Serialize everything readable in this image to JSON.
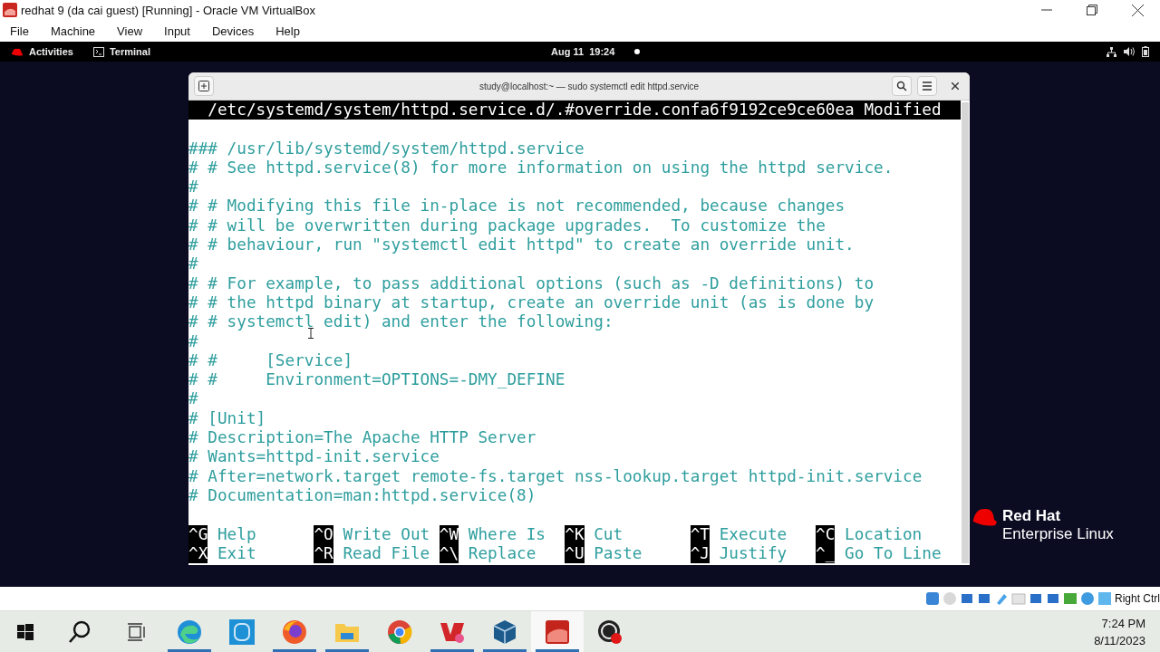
{
  "window": {
    "title": "redhat 9 (da cai guest) [Running] - Oracle VM VirtualBox"
  },
  "menu": [
    "File",
    "Machine",
    "View",
    "Input",
    "Devices",
    "Help"
  ],
  "gnome_bar": {
    "activities": "Activities",
    "app": "Terminal",
    "clock": "Aug 11  19:24"
  },
  "terminal": {
    "title": "study@localhost:~ — sudo systemctl edit httpd.service",
    "header": "/etc/systemd/system/httpd.service.d/.#override.confa6f9192ce9ce60ea Modified",
    "lines": [
      "### /usr/lib/systemd/system/httpd.service",
      "# # See httpd.service(8) for more information on using the httpd service.",
      "#",
      "# # Modifying this file in-place is not recommended, because changes",
      "# # will be overwritten during package upgrades.  To customize the",
      "# # behaviour, run \"systemctl edit httpd\" to create an override unit.",
      "#",
      "# # For example, to pass additional options (such as -D definitions) to",
      "# # the httpd binary at startup, create an override unit (as is done by",
      "# # systemctl edit) and enter the following:",
      "#",
      "# #     [Service]",
      "# #     Environment=OPTIONS=-DMY_DEFINE",
      "#",
      "# [Unit]",
      "# Description=The Apache HTTP Server",
      "# Wants=httpd-init.service",
      "# After=network.target remote-fs.target nss-lookup.target httpd-init.service",
      "# Documentation=man:httpd.service(8)"
    ],
    "shortcuts": [
      {
        "key": "^G",
        "label": "Help"
      },
      {
        "key": "^O",
        "label": "Write Out"
      },
      {
        "key": "^W",
        "label": "Where Is"
      },
      {
        "key": "^K",
        "label": "Cut"
      },
      {
        "key": "^T",
        "label": "Execute"
      },
      {
        "key": "^C",
        "label": "Location"
      },
      {
        "key": "^X",
        "label": "Exit"
      },
      {
        "key": "^R",
        "label": "Read File"
      },
      {
        "key": "^\\",
        "label": "Replace"
      },
      {
        "key": "^U",
        "label": "Paste"
      },
      {
        "key": "^J",
        "label": "Justify"
      },
      {
        "key": "^_",
        "label": "Go To Line"
      }
    ]
  },
  "brand": {
    "name": "Red Hat",
    "product": "Enterprise Linux"
  },
  "vm_status": {
    "host_key": "Right Ctrl"
  },
  "taskbar": {
    "apps": [
      {
        "kind": "edge",
        "running": true,
        "selected": false
      },
      {
        "kind": "photos",
        "running": false,
        "selected": false
      },
      {
        "kind": "firefox",
        "running": true,
        "selected": false
      },
      {
        "kind": "explorer",
        "running": true,
        "selected": false
      },
      {
        "kind": "chrome",
        "running": false,
        "selected": false
      },
      {
        "kind": "vp",
        "running": true,
        "selected": false
      },
      {
        "kind": "virtualbox",
        "running": true,
        "selected": false
      },
      {
        "kind": "redhat",
        "running": true,
        "selected": true
      },
      {
        "kind": "obs",
        "running": false,
        "selected": false
      }
    ],
    "time": "7:24 PM",
    "date": "8/11/2023"
  }
}
